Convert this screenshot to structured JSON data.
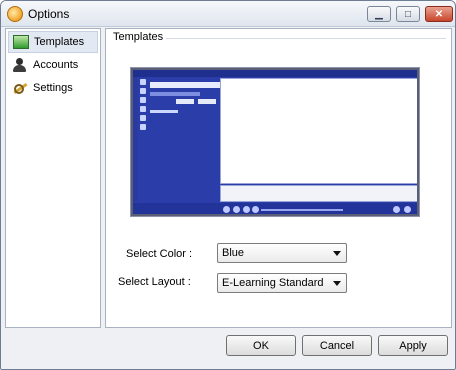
{
  "window": {
    "title": "Options"
  },
  "titlebar_buttons": {
    "minimize": "▁",
    "maximize": "□",
    "close": "✕"
  },
  "sidebar": {
    "items": [
      {
        "label": "Templates",
        "icon": "template-icon",
        "selected": true
      },
      {
        "label": "Accounts",
        "icon": "user-icon",
        "selected": false
      },
      {
        "label": "Settings",
        "icon": "wrench-icon",
        "selected": false
      }
    ]
  },
  "panel": {
    "title": "Templates",
    "color_label": "Select Color :",
    "color_value": "Blue",
    "layout_label": "Select Layout :",
    "layout_value": "E-Learning Standard"
  },
  "buttons": {
    "ok": "OK",
    "cancel": "Cancel",
    "apply": "Apply"
  },
  "colors": {
    "preview_blue": "#2b3da8",
    "window_bg": "#eef0f4",
    "border": "#a9b2c2",
    "close_red": "#c8452c"
  }
}
